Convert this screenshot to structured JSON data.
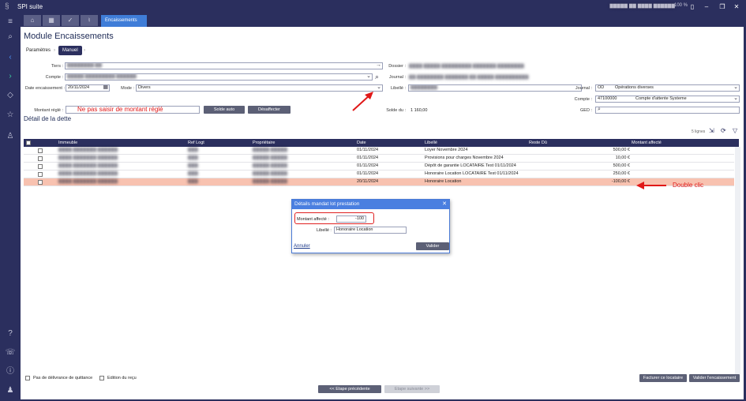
{
  "app": {
    "title": "SPI suite",
    "user_info": "▇▇▇▇▇ ▇▇ ▇▇▇▇ ▇▇▇▇▇▇",
    "zoom": "100 %"
  },
  "tabs": {
    "active_label": "Encaissements"
  },
  "module": {
    "title": "Module Encaissements"
  },
  "breadcrumb": {
    "step1": "Paramètres",
    "step2": "Manuel"
  },
  "form": {
    "tiers_label": "Tiers :",
    "tiers_value": "▇▇▇▇▇▇▇▇ ▇▇",
    "compte_label": "Compte :",
    "compte_value": "▇▇▇▇▇ ▇▇▇▇▇▇▇▇▇ ▇▇▇▇▇▇",
    "date_label": "Date encaissement :",
    "date_value": "20/11/2024",
    "mode_label": "Mode :",
    "mode_value": "Divers",
    "montant_label": "Montant réglé :",
    "montant_value": "",
    "dossier_label": "Dossier :",
    "dossier_value": "▇▇▇▇ ▇▇▇▇▇ ▇▇▇▇▇▇▇▇▇ ▇▇▇▇▇▇▇ ▇▇▇▇▇▇▇▇",
    "journal_label": "Journal :",
    "journal_value": "▇▇ ▇▇▇▇▇▇▇▇ ▇▇▇▇▇▇▇ ▇▇ ▇▇▇▇▇ ▇▇▇▇▇▇▇▇▇▇",
    "libelle_label": "Libellé :",
    "libelle_value": "▇▇▇▇▇▇▇▇",
    "solde_label": "Solde du :",
    "solde_value": "1 160,00",
    "journal2_label": "Journal :",
    "journal2_code": "OD",
    "journal2_name": "Opérations diverses",
    "compte2_label": "Compte :",
    "compte2_code": "47100000",
    "compte2_name": "Compte d'attente Systeme",
    "ged_label": "GED :",
    "solde_auto": "Solde auto",
    "desaffecter": "Désaffecter"
  },
  "section": {
    "title": "Détail de la dette",
    "count": "5 lignes"
  },
  "table": {
    "headers": [
      "Immeuble",
      "Ref Logt",
      "Propriétaire",
      "Date",
      "Libellé",
      "Reste Dû",
      "Montant affecté"
    ],
    "rows": [
      {
        "immeuble": "▇▇▇▇ ▇▇▇▇▇▇▇ ▇▇▇▇▇▇",
        "ref": "▇▇▇",
        "prop": "▇▇▇▇▇ ▇▇▇▇▇",
        "date": "01/11/2024",
        "libelle": "Loyer Novembre      2024",
        "reste": "",
        "montant": "500,00 €"
      },
      {
        "immeuble": "▇▇▇▇ ▇▇▇▇▇▇▇ ▇▇▇▇▇▇",
        "ref": "▇▇▇",
        "prop": "▇▇▇▇▇ ▇▇▇▇▇",
        "date": "01/11/2024",
        "libelle": "Provisions pour charges Novembre      2024",
        "reste": "",
        "montant": "10,00 €"
      },
      {
        "immeuble": "▇▇▇▇ ▇▇▇▇▇▇▇ ▇▇▇▇▇▇",
        "ref": "▇▇▇",
        "prop": "▇▇▇▇▇ ▇▇▇▇▇",
        "date": "01/11/2024",
        "libelle": "Dépôt de garantie LOCATAIRE Test 01/11/2024",
        "reste": "",
        "montant": "500,00 €"
      },
      {
        "immeuble": "▇▇▇▇ ▇▇▇▇▇▇▇ ▇▇▇▇▇▇",
        "ref": "▇▇▇",
        "prop": "▇▇▇▇▇ ▇▇▇▇▇",
        "date": "01/11/2024",
        "libelle": "Honoraire Location LOCATAIRE Test 01/11/2024",
        "reste": "",
        "montant": "250,00 €"
      },
      {
        "immeuble": "▇▇▇▇ ▇▇▇▇▇▇▇ ▇▇▇▇▇▇",
        "ref": "▇▇▇",
        "prop": "▇▇▇▇▇ ▇▇▇▇▇",
        "date": "20/11/2024",
        "libelle": "Honoraire Location",
        "reste": "",
        "montant": "-100,00 €"
      }
    ]
  },
  "dialog": {
    "title": "Détails mandat lot prestation",
    "montant_label": "Montant affecté :",
    "montant_value": "-100",
    "libelle_label": "Libellé :",
    "libelle_value": "Honoraire Location",
    "annuler": "Annuler",
    "valider": "Valider"
  },
  "annotations": {
    "montant_warning": "Ne pas saisir de montant réglé",
    "double_clic": "Double clic"
  },
  "footer": {
    "chk1": "Pas de délivrance de quittance",
    "chk2": "Edition du reçu",
    "facturer": "Facturer ce locataire",
    "valider_enc": "Valider l'encaissement",
    "prev": "<< Etape précédente",
    "next": "Etape suivante >>"
  },
  "colors": {
    "navy": "#2b2f5e",
    "accent": "#3f7dd8",
    "selected_row": "#f8c2b0",
    "annotation": "#e01818"
  }
}
